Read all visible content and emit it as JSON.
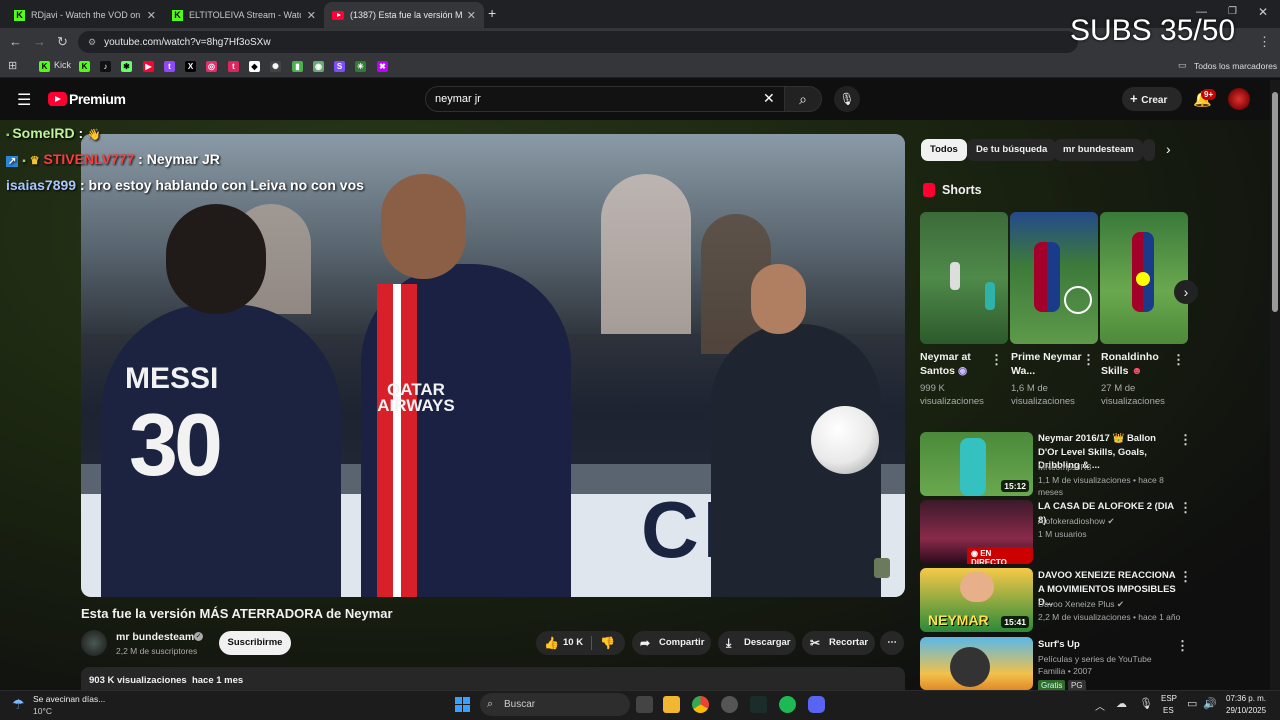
{
  "browser": {
    "tabs": [
      {
        "title": "RDjavi - Watch the VOD on Kick",
        "icon": "kick-icon"
      },
      {
        "title": "ELTITOLEIVA Stream - Watch Li",
        "icon": "kick-icon"
      },
      {
        "title": "(1387) Esta fue la versión MÁS",
        "icon": "youtube-icon"
      }
    ],
    "new_tab": "+",
    "url": "youtube.com/watch?v=8hg7Hf3oSXw",
    "bookmarks": [
      {
        "label": "Kick",
        "icon": "kick-icon",
        "color": "#53fc18"
      }
    ],
    "all_bookmarks": "Todos los marcadores"
  },
  "overlay": {
    "subs": "SUBS 35/50",
    "chat": [
      {
        "user": "SomeIRD",
        "user_color": "#bff19a",
        "message": ""
      },
      {
        "user": "STIVENLV777",
        "user_color": "#ff3b3b",
        "message": "Neymar JR"
      },
      {
        "user": "isaias7899",
        "user_color": "#a9c7ff",
        "message": "bro estoy hablando con Leiva no con vos"
      }
    ]
  },
  "youtube": {
    "logo": "Premium",
    "search_value": "neymar jr",
    "create": "Crear",
    "notif_badge": "9+",
    "video_title": "Esta fue la versión MÁS ATERRADORA de Neymar",
    "channel": {
      "name": "mr bundesteam",
      "subs": "2,2 M de suscriptores"
    },
    "subscribe": "Suscribirme",
    "likes": "10 K",
    "share": "Compartir",
    "download": "Descargar",
    "clip": "Recortar",
    "views_line": "903 K visualizaciones  hace 1 mes",
    "jersey": {
      "name": "MESSI",
      "number": "30",
      "sponsor": "QATAR AIRWAYS"
    },
    "chips": [
      "Todos",
      "De tu búsqueda",
      "mr bundesteam"
    ],
    "shorts_header": "Shorts",
    "shorts": [
      {
        "title": "Neymar at Santos",
        "views": "999 K visualizaciones"
      },
      {
        "title": "Prime Neymar Wa...",
        "views": "1,6 M de visualizaciones"
      },
      {
        "title": "Ronaldinho Skills",
        "views": "27 M de visualizaciones"
      }
    ],
    "related": [
      {
        "title": "Neymar 2016/17 👑 Ballon D'Or Level Skills, Goals, Dribbling & ...",
        "channel": "MNcompsJR3",
        "meta": "1,1 M de visualizaciones • hace 8 meses",
        "duration": "15:12",
        "live": ""
      },
      {
        "title": "LA CASA DE ALOFOKE 2 (DIA 8)",
        "channel": "Alofokeradioshow",
        "meta": "1 M usuarios",
        "duration": "",
        "live": "EN DIRECTO"
      },
      {
        "title": "DAVOO XENEIZE REACCIONA A MOVIMIENTOS IMPOSIBLES D...",
        "channel": "Davoo Xeneize Plus",
        "meta": "2,2 M de visualizaciones • hace 1 año",
        "duration": "15:41",
        "thumb_text": "NEYMAR",
        "live": ""
      },
      {
        "title": "Surf's Up",
        "channel": "Películas y series de YouTube",
        "meta": "Familia • 2007",
        "duration": "",
        "badges": [
          "Gratis",
          "PG"
        ],
        "live": ""
      }
    ]
  },
  "taskbar": {
    "weather_title": "Se avecinan días...",
    "weather_temp": "10°C",
    "search": "Buscar",
    "lang1": "ESP",
    "lang2": "ES",
    "time": "07:36 p. m.",
    "date": "29/10/2025"
  },
  "colors": {
    "accent": "#ff0033",
    "kick": "#53fc18",
    "chip_bg": "#272727"
  }
}
